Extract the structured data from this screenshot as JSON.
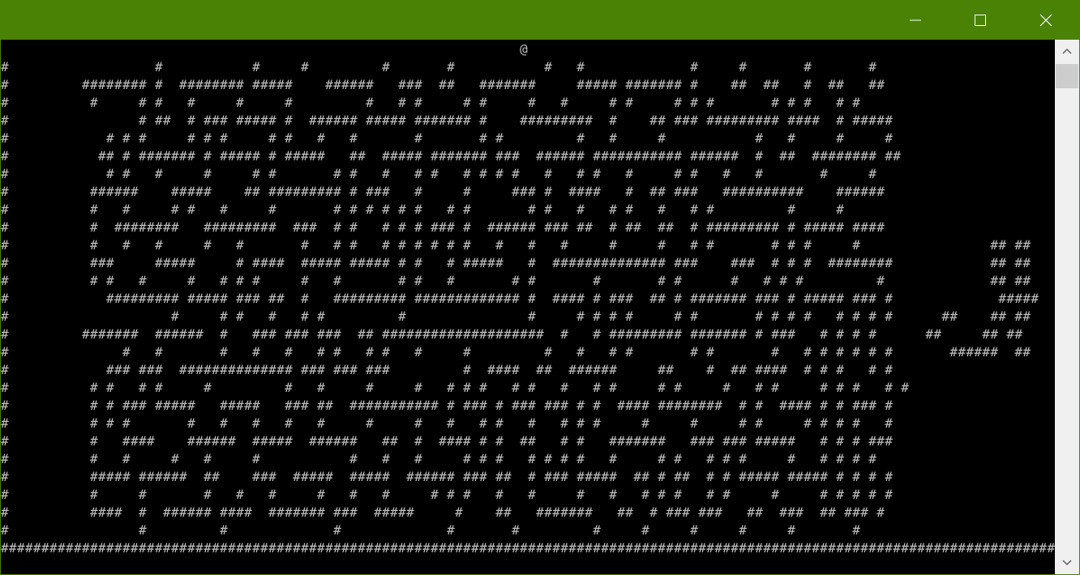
{
  "window": {
    "titlebar_color": "#498205",
    "buttons": [
      {
        "name": "minimize",
        "icon": "minimize-icon"
      },
      {
        "name": "maximize",
        "icon": "maximize-icon"
      },
      {
        "name": "close",
        "icon": "close-icon"
      }
    ]
  },
  "console": {
    "background": "#000000",
    "foreground": "#c0c0c0",
    "text": "                                                                @\n#                  #           #     #         #       #           #   #             #     #       #       #\n#         ######## #  ######## #####    ######   ###  ##   #######     ##### ####### #    ##  ##   #  ##   ##\n#          #     # #   #     #     #         #   # #     # #     #   #     # #     # # #       # # #   # #\n#                # ##  # ### ##### #  ###### ##### ####### #    #########  #    ## ### ######### ####  # #####\n#            # # #     # # #     # #   #   #       #       # #         #   #     #           #   #     #     #\n#           ## # ####### # ##### # #####   ##  ##### ####### ###  ###### ########### ######  #  ##  ######## ##\n#            # #   #     #     # #       # #   #   # #   # # # #   #   # #   #     # #   #   #       #     #\n#          ######    #####    ## ######### # ###   #     #     ### #  ####   #  ## ###   ##########    ######\n#          #   #     # #   #     #       # # # # # #   # #       # #   #   # #   #   # #         #     #\n#          #  ########   #########  ###  # #   # # # ### #  ###### ### ##  # ##  ##  # ######### # ##### ####\n#          #   #   #     #   #       #   # #   # # # # # #   #   #   #     #     #   # #       # # #     #                ## ##\n#          ###     #####     # ####  ##### ##### # #   # #####   #  ############## ###    ###  # # #  ########            ## ##\n#          # #   #     #   # # #     #   #       # #   #       # #       #       # #      #   # # #         #             ## ##\n#            ######### ##### ### ##  #   ######### ############# #  #### # ###  ## # ####### ### # ##### ### #             #####\n#                    #     # #   #   # #         #               #     # # # #     # #       # # # #   # # # #      ##    ## ##\n#         #######  ######  #   ### ### ###  ## ####################  #   # ######### ####### # ###   # # # #      ##     ## ##\n#              #   #       #   #   #   # #   # #   #     #         #   #   # #       # #       #   # # # # # #       ######  ##\n#            ### ###  ############## ### ### ###         #  ####  ##  ######     ##    #  ## ####  # # #   # #\n#          # #   # #     #         #   #     #     #   # # #   # #   #   # #     # #     #   # #     # # #   # #\n#          # # ### #####   #####   ### ##  ########### # ### # ### ### # #  #### ########  # #  #### # # ### #\n#          # # #       #   #   #   #   #     #     #   #   # #   #   # # #     #     #     # #     # # # #   #\n#          #   ####    ######  #####  ######   ##  #  #### # #  ##   # #   #######   ### ### #####   # # # ###\n#          #   #     #   #     #           #   #   #     # # #   # # # #   #     # #   # # #     #   # # # #\n#          ##### ######  ##    ###  #####  #####  ###### ### ##  # ### #####  ## # ##  # # ##### ##### # # # #\n#          #     #       #   #   #     #   #   #     # # #   #   #     #   #   # # #   # #     #     # # # # #\n#          ####  #  ###### ####  ####### ###  #####     #    ##   #######   ##  # ### ###   ##  ###  ## ### #\n#                #         #             #             #       #         #     #     #     #     #       #\n#####################################################################################################################################"
  },
  "scrollbar": {
    "up_icon": "chevron-up-icon",
    "down_icon": "chevron-down-icon"
  }
}
